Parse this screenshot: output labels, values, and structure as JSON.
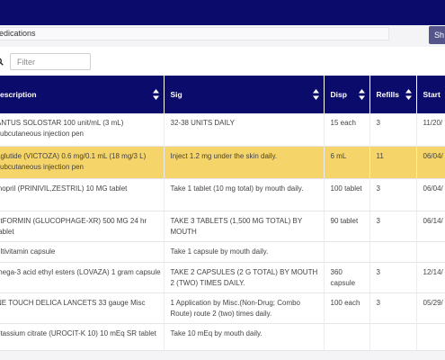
{
  "header": {
    "tab_partial": "edications",
    "show_button": "Sh"
  },
  "filter": {
    "placeholder": "Filter"
  },
  "columns": {
    "description": "escription",
    "sig": "Sig",
    "disp": "Disp",
    "refills": "Refills",
    "start": "Start"
  },
  "rows": [
    {
      "description": "ANTUS SOLOSTAR 100 unit/mL (3 mL) subcutaneous injection pen",
      "sig": "32-38 UNITS DAILY",
      "disp": "15 each",
      "refills": "3",
      "start": "11/20/"
    },
    {
      "description": "aglutide (VICTOZA) 0.6 mg/0.1 mL (18 mg/3 L) subcutaneous injection pen",
      "sig": "Inject 1.2 mg under the skin daily.",
      "disp": "6 mL",
      "refills": "11",
      "start": "06/04/",
      "highlight": true
    },
    {
      "description": "inopril (PRINIVIL,ZESTRIL) 10 MG tablet",
      "sig": "Take 1 tablet (10 mg total) by mouth daily.",
      "disp": "100 tablet",
      "refills": "3",
      "start": "06/04/"
    },
    {
      "description": "etFORMIN (GLUCOPHAGE-XR) 500 MG 24 hr tablet",
      "sig": "TAKE 3 TABLETS (1,500 MG TOTAL) BY MOUTH",
      "disp": "90 tablet",
      "refills": "3",
      "start": "06/14/"
    },
    {
      "description": "ultivitamin capsule",
      "sig": "Take 1 capsule by mouth daily.",
      "disp": "",
      "refills": "",
      "start": ""
    },
    {
      "description": "mega-3 acid ethyl esters (LOVAZA) 1 gram capsule",
      "sig": "TAKE 2 CAPSULES (2 G TOTAL) BY MOUTH 2 (TWO) TIMES DAILY.",
      "disp": "360 capsule",
      "refills": "3",
      "start": "12/14/"
    },
    {
      "description": "NE TOUCH DELICA LANCETS 33 gauge Misc",
      "sig": "1 Application by Misc.(Non-Drug; Combo Route) route 2 (two) times daily.",
      "disp": "100 each",
      "refills": "3",
      "start": "05/29/"
    },
    {
      "description": "otassium citrate (UROCIT-K 10) 10 mEq SR tablet",
      "sig": "Take 10 mEq by mouth daily.",
      "disp": "",
      "refills": "",
      "start": ""
    }
  ],
  "colors": {
    "navy": "#0b0b6b",
    "highlight": "#f5d46a",
    "button": "#55558c"
  },
  "icons": {
    "search": "search-icon",
    "sort": "sort-icon"
  }
}
